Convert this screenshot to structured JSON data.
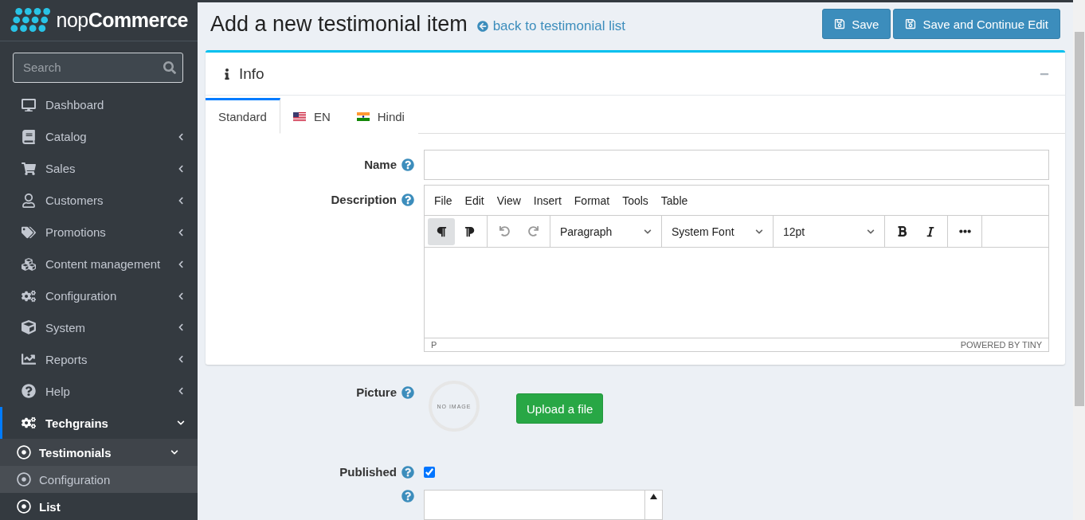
{
  "logo": {
    "text": "nop**Commerce**"
  },
  "sidebar": {
    "search": {
      "placeholder": "Search"
    },
    "items": [
      {
        "label": "Dashboard",
        "kind": "link"
      },
      {
        "label": "Catalog",
        "kind": "menu",
        "expanded": false
      },
      {
        "label": "Sales",
        "kind": "menu",
        "expanded": false
      },
      {
        "label": "Customers",
        "kind": "menu",
        "expanded": false
      },
      {
        "label": "Promotions",
        "kind": "menu",
        "expanded": false
      },
      {
        "label": "Content management",
        "kind": "menu",
        "expanded": false
      },
      {
        "label": "Configuration",
        "kind": "menu",
        "expanded": false
      },
      {
        "label": "System",
        "kind": "menu",
        "expanded": false
      },
      {
        "label": "Reports",
        "kind": "menu",
        "expanded": false
      },
      {
        "label": "Help",
        "kind": "menu",
        "expanded": false
      },
      {
        "label": "Techgrains",
        "kind": "menu",
        "expanded": true,
        "children": [
          {
            "label": "Testimonials",
            "kind": "menu",
            "expanded": true,
            "selected": true,
            "children": [
              {
                "label": "Configuration",
                "selected": false
              },
              {
                "label": "List",
                "selected": true
              }
            ]
          }
        ]
      }
    ]
  },
  "header": {
    "title": "Add a new testimonial item",
    "back_link": "back to testimonial list",
    "buttons": [
      "Save",
      "Save and Continue Edit"
    ]
  },
  "card": {
    "title": "Info",
    "tabs": [
      {
        "label": "Standard",
        "selected": true
      },
      {
        "label": "EN",
        "selected": false
      },
      {
        "label": "Hindi",
        "selected": false
      }
    ],
    "name": {
      "label": "Name"
    },
    "description": {
      "label": "Description",
      "menu": [
        "File",
        "Edit",
        "View",
        "Insert",
        "Format",
        "Tools",
        "Table"
      ],
      "toolbar": [
        {
          "kind": "ltr",
          "active": true
        },
        {
          "kind": "rtl",
          "active": false
        },
        {
          "kind": "undo",
          "disabled": true
        },
        {
          "kind": "redo",
          "disabled": true
        },
        {
          "kind": "select",
          "value": "Paragraph"
        },
        {
          "kind": "select",
          "value": "System Font"
        },
        {
          "kind": "select",
          "value": "12pt"
        },
        {
          "kind": "bold"
        },
        {
          "kind": "italic"
        },
        {
          "kind": "more"
        }
      ],
      "path": "P",
      "branding": "POWERED BY TINY"
    }
  },
  "picture": {
    "label": "Picture",
    "placeholder_text": "NO IMAGE",
    "upload_button": "Upload a file"
  },
  "published": {
    "label": "Published",
    "checked": true
  },
  "display_order": {
    "kind": "number"
  }
}
